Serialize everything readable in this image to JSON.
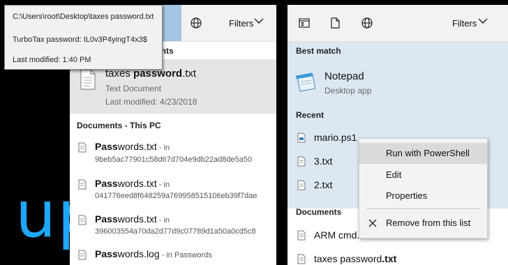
{
  "background": {
    "text": "up",
    "accent_color": "#1ea7ff"
  },
  "tooltip": {
    "path": "C:\\Users\\root\\Desktop\\taxes password.txt",
    "content": "TurboTax password: IL0v3P4yingT4x3$",
    "modified": "Last modified: 1:40 PM"
  },
  "left": {
    "tab_label": "ents",
    "filters": "Filters",
    "section_header_partial": "ents",
    "best": {
      "name_pre": "taxes ",
      "name_bold": "pass",
      "name_mid": "word",
      "name_post": ".txt",
      "type": "Text Document",
      "modified": "Last modified: 4/23/2018"
    },
    "docs_header": "Documents - This PC",
    "docs": [
      {
        "name_bold": "Pass",
        "name_rest": "words.txt",
        "suffix": " - in",
        "path": "9beb5ac77901c58d67d704e9db22ad8de5a50"
      },
      {
        "name_bold": "Pass",
        "name_rest": "words.txt",
        "suffix": " - in",
        "path": "041776eed8f648259a769958515106eb39f7dae"
      },
      {
        "name_bold": "Pass",
        "name_rest": "words.txt",
        "suffix": " - in",
        "path": "396003554a70da2d77d9c07789d1a50a0cd5c8"
      },
      {
        "name_bold": "Pass",
        "name_rest": "words.log",
        "suffix": " - in Passwords"
      }
    ]
  },
  "right": {
    "filters": "Filters",
    "best_header": "Best match",
    "best": {
      "name": "Notepad",
      "type": "Desktop app"
    },
    "recent_header": "Recent",
    "recent": [
      "mario.ps1",
      "3.txt",
      "2.txt"
    ],
    "docs_header": "Documents",
    "docs": [
      {
        "name": "ARM cmd."
      },
      {
        "name_pre": "taxes pass",
        "name_bold": "word",
        "name_post": ".txt"
      }
    ]
  },
  "context_menu": {
    "items": [
      "Run with PowerShell",
      "Edit",
      "Properties"
    ],
    "remove": "Remove from this list"
  }
}
